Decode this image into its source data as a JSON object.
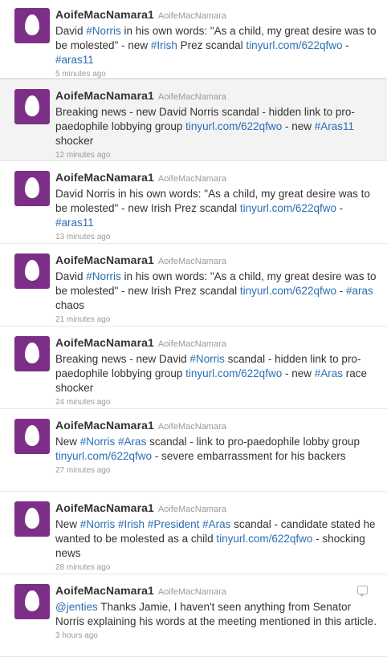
{
  "colors": {
    "avatar_bg": "#7d2e86",
    "link": "#2a6eb5",
    "highlight_bg": "#f3f3f3"
  },
  "tweets": [
    {
      "screen_name": "AoifeMacNamara1",
      "full_name": "AoifeMacNamara",
      "highlighted": false,
      "time": "5 minutes ago",
      "segments": [
        {
          "text": "David ",
          "link": false
        },
        {
          "text": "#Norris",
          "link": true
        },
        {
          "text": " in his own words: \"As a child, my great desire was to be molested\" - new ",
          "link": false
        },
        {
          "text": "#Irish",
          "link": true
        },
        {
          "text": " Prez scandal ",
          "link": false
        },
        {
          "text": "tinyurl.com/622qfwo",
          "link": true
        },
        {
          "text": " - ",
          "link": false
        },
        {
          "text": "#aras11",
          "link": true
        }
      ]
    },
    {
      "screen_name": "AoifeMacNamara1",
      "full_name": "AoifeMacNamara",
      "highlighted": true,
      "time": "12 minutes ago",
      "segments": [
        {
          "text": "Breaking news - new David Norris scandal - hidden link to pro-paedophile lobbying group ",
          "link": false
        },
        {
          "text": "tinyurl.com/622qfwo",
          "link": true
        },
        {
          "text": " - new ",
          "link": false
        },
        {
          "text": "#Aras11",
          "link": true
        },
        {
          "text": " shocker",
          "link": false
        }
      ]
    },
    {
      "screen_name": "AoifeMacNamara1",
      "full_name": "AoifeMacNamara",
      "highlighted": false,
      "time": "13 minutes ago",
      "segments": [
        {
          "text": "David Norris in his own words: \"As a child, my great desire was to be molested\" - new Irish Prez scandal ",
          "link": false
        },
        {
          "text": "tinyurl.com/622qfwo",
          "link": true
        },
        {
          "text": " - ",
          "link": false
        },
        {
          "text": "#aras11",
          "link": true
        }
      ]
    },
    {
      "screen_name": "AoifeMacNamara1",
      "full_name": "AoifeMacNamara",
      "highlighted": false,
      "time": "21 minutes ago",
      "segments": [
        {
          "text": "David ",
          "link": false
        },
        {
          "text": "#Norris",
          "link": true
        },
        {
          "text": " in his own words: \"As a child, my great desire was to be molested\" - new Irish Prez scandal ",
          "link": false
        },
        {
          "text": "tinyurl.com/622qfwo",
          "link": true
        },
        {
          "text": " - ",
          "link": false
        },
        {
          "text": "#aras",
          "link": true
        },
        {
          "text": " chaos",
          "link": false
        }
      ]
    },
    {
      "screen_name": "AoifeMacNamara1",
      "full_name": "AoifeMacNamara",
      "highlighted": false,
      "time": "24 minutes ago",
      "segments": [
        {
          "text": "Breaking news - new David ",
          "link": false
        },
        {
          "text": "#Norris",
          "link": true
        },
        {
          "text": " scandal - hidden link to pro-paedophile lobbying group ",
          "link": false
        },
        {
          "text": "tinyurl.com/622qfwo",
          "link": true
        },
        {
          "text": " - new ",
          "link": false
        },
        {
          "text": "#Aras",
          "link": true
        },
        {
          "text": " race shocker",
          "link": false
        }
      ]
    },
    {
      "screen_name": "AoifeMacNamara1",
      "full_name": "AoifeMacNamara",
      "highlighted": false,
      "time": "27 minutes ago",
      "segments": [
        {
          "text": "New ",
          "link": false
        },
        {
          "text": "#Norris",
          "link": true
        },
        {
          "text": " ",
          "link": false
        },
        {
          "text": "#Aras",
          "link": true
        },
        {
          "text": " scandal - link to pro-paedophile lobby group ",
          "link": false
        },
        {
          "text": "tinyurl.com/622qfwo",
          "link": true
        },
        {
          "text": " - severe embarrassment for his backers",
          "link": false
        }
      ]
    },
    {
      "screen_name": "AoifeMacNamara1",
      "full_name": "AoifeMacNamara",
      "highlighted": false,
      "time": "28 minutes ago",
      "segments": [
        {
          "text": "New ",
          "link": false
        },
        {
          "text": "#Norris",
          "link": true
        },
        {
          "text": " ",
          "link": false
        },
        {
          "text": "#Irish",
          "link": true
        },
        {
          "text": " ",
          "link": false
        },
        {
          "text": "#President",
          "link": true
        },
        {
          "text": " ",
          "link": false
        },
        {
          "text": "#Aras",
          "link": true
        },
        {
          "text": " scandal - candidate stated he wanted to be molested as a child ",
          "link": false
        },
        {
          "text": "tinyurl.com/622qfwo",
          "link": true
        },
        {
          "text": " - shocking news",
          "link": false
        }
      ]
    },
    {
      "screen_name": "AoifeMacNamara1",
      "full_name": "AoifeMacNamara",
      "highlighted": false,
      "reply_icon": "conversation-icon",
      "time": "3 hours ago",
      "segments": [
        {
          "text": "@jenties",
          "link": true
        },
        {
          "text": " Thanks Jamie, I haven't seen anything from Senator Norris explaining his words at the meeting mentioned in this article.",
          "link": false
        }
      ]
    }
  ]
}
